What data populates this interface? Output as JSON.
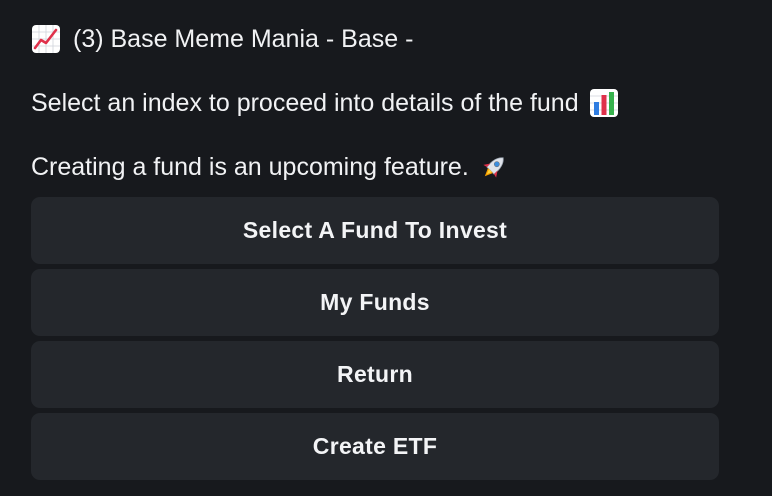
{
  "message": {
    "title_icon": "chart-increasing-icon",
    "title": "(3) Base Meme Mania - Base -",
    "instruction": "Select an index to proceed into details of the fund",
    "instruction_icon": "bar-chart-icon",
    "notice": "Creating a fund is an upcoming feature.",
    "notice_icon": "rocket-icon"
  },
  "buttons": [
    {
      "label": "Select A Fund To Invest"
    },
    {
      "label": "My Funds"
    },
    {
      "label": "Return"
    },
    {
      "label": "Create ETF"
    }
  ],
  "colors": {
    "background": "#17191d",
    "button": "#24272c",
    "text": "#f1f2f4"
  }
}
